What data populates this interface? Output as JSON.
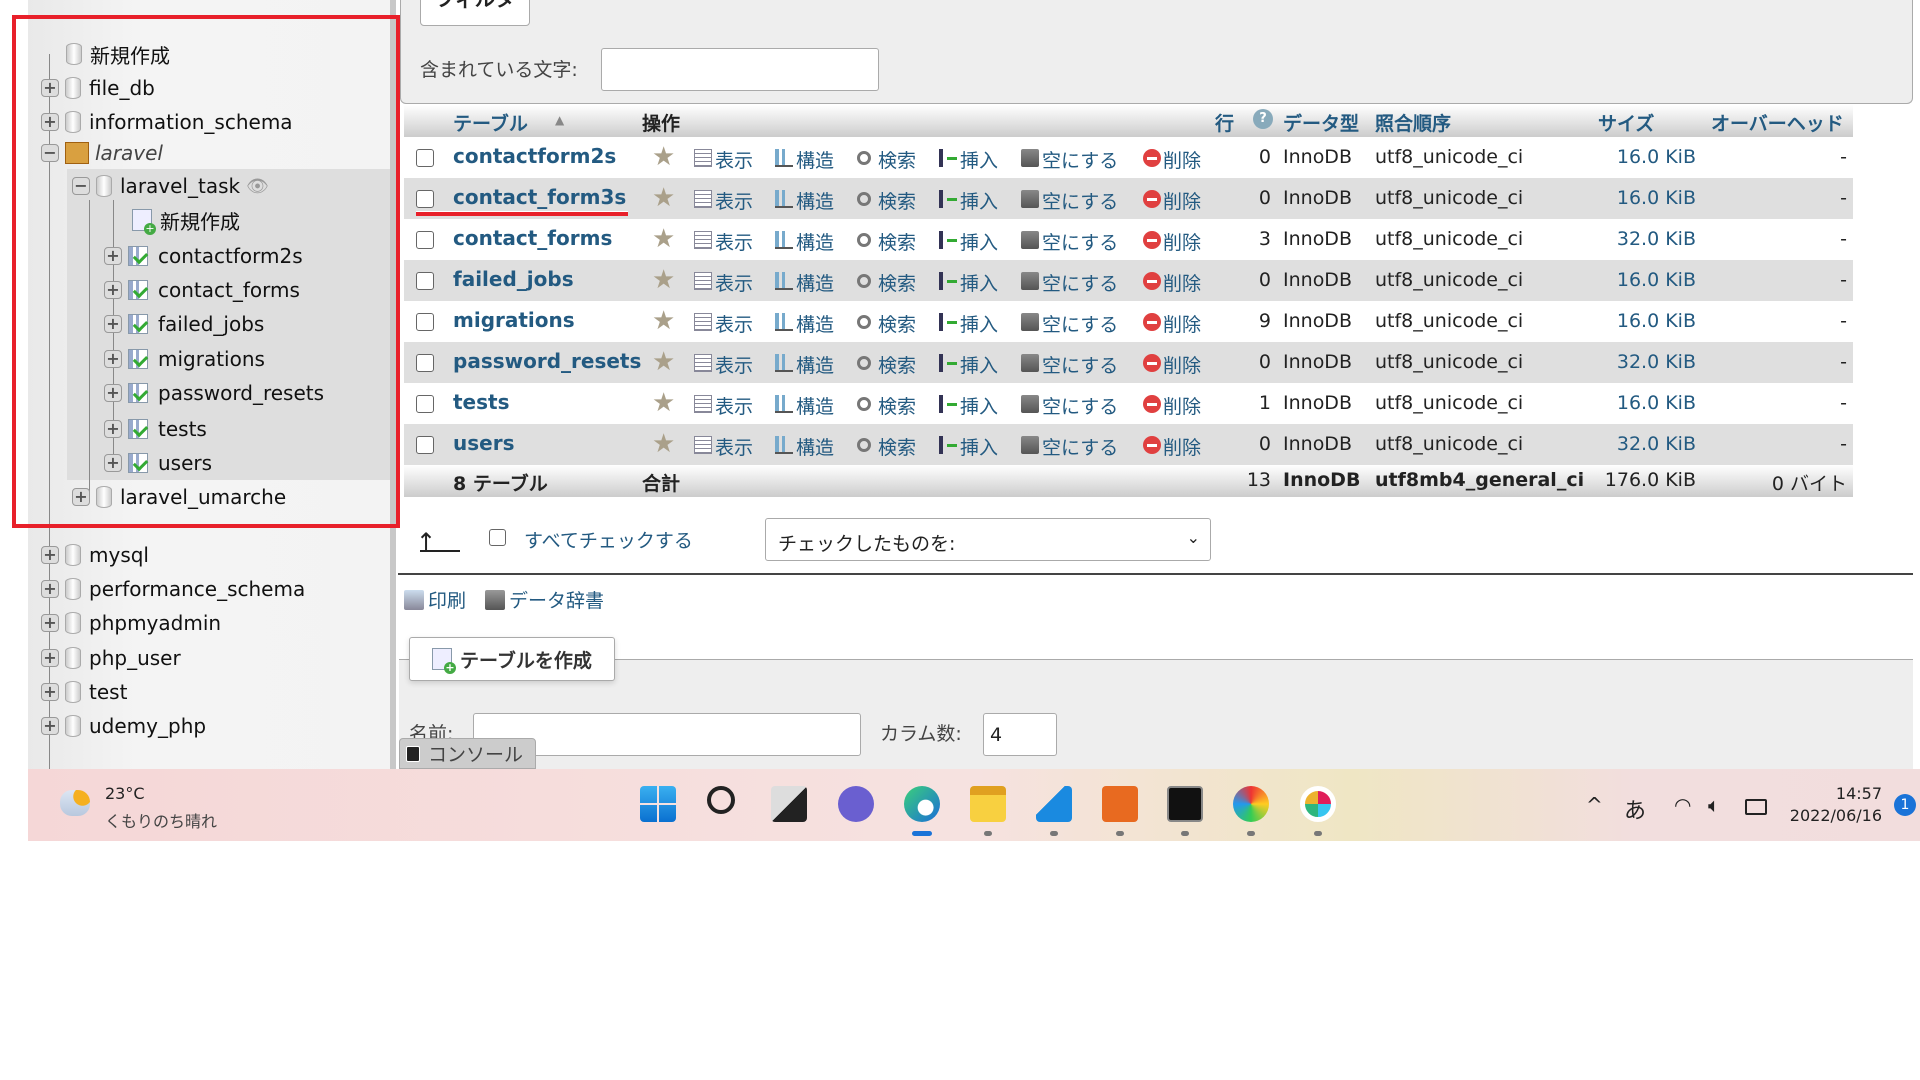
{
  "sidebar": {
    "items": [
      {
        "label": "新規作成",
        "kind": "new"
      },
      {
        "label": "file_db",
        "kind": "db"
      },
      {
        "label": "information_schema",
        "kind": "db"
      },
      {
        "label": "laravel",
        "kind": "group"
      },
      {
        "label": "laravel_task",
        "kind": "db-open"
      },
      {
        "label": "新規作成",
        "kind": "new-table"
      },
      {
        "label": "contactform2s",
        "kind": "table"
      },
      {
        "label": "contact_forms",
        "kind": "table"
      },
      {
        "label": "failed_jobs",
        "kind": "table"
      },
      {
        "label": "migrations",
        "kind": "table"
      },
      {
        "label": "password_resets",
        "kind": "table"
      },
      {
        "label": "tests",
        "kind": "table"
      },
      {
        "label": "users",
        "kind": "table"
      },
      {
        "label": "laravel_umarche",
        "kind": "db"
      },
      {
        "label": "mysql",
        "kind": "db"
      },
      {
        "label": "performance_schema",
        "kind": "db"
      },
      {
        "label": "phpmyadmin",
        "kind": "db"
      },
      {
        "label": "php_user",
        "kind": "db"
      },
      {
        "label": "test",
        "kind": "db"
      },
      {
        "label": "udemy_php",
        "kind": "db"
      }
    ]
  },
  "filter": {
    "tab": "フィルタ",
    "label": "含まれている文字:",
    "value": ""
  },
  "table": {
    "headers": {
      "table": "テーブル",
      "action": "操作",
      "rows": "行",
      "type": "データ型",
      "collation": "照合順序",
      "size": "サイズ",
      "overhead": "オーバーヘッド"
    },
    "actions": {
      "browse": "表示",
      "structure": "構造",
      "search": "検索",
      "insert": "挿入",
      "empty": "空にする",
      "drop": "削除"
    },
    "rows": [
      {
        "name": "contactform2s",
        "rows": "0",
        "type": "InnoDB",
        "collation": "utf8_unicode_ci",
        "size": "16.0 KiB",
        "overhead": "-"
      },
      {
        "name": "contact_form3s",
        "rows": "0",
        "type": "InnoDB",
        "collation": "utf8_unicode_ci",
        "size": "16.0 KiB",
        "overhead": "-"
      },
      {
        "name": "contact_forms",
        "rows": "3",
        "type": "InnoDB",
        "collation": "utf8_unicode_ci",
        "size": "32.0 KiB",
        "overhead": "-"
      },
      {
        "name": "failed_jobs",
        "rows": "0",
        "type": "InnoDB",
        "collation": "utf8_unicode_ci",
        "size": "16.0 KiB",
        "overhead": "-"
      },
      {
        "name": "migrations",
        "rows": "9",
        "type": "InnoDB",
        "collation": "utf8_unicode_ci",
        "size": "16.0 KiB",
        "overhead": "-"
      },
      {
        "name": "password_resets",
        "rows": "0",
        "type": "InnoDB",
        "collation": "utf8_unicode_ci",
        "size": "32.0 KiB",
        "overhead": "-"
      },
      {
        "name": "tests",
        "rows": "1",
        "type": "InnoDB",
        "collation": "utf8_unicode_ci",
        "size": "16.0 KiB",
        "overhead": "-"
      },
      {
        "name": "users",
        "rows": "0",
        "type": "InnoDB",
        "collation": "utf8_unicode_ci",
        "size": "32.0 KiB",
        "overhead": "-"
      }
    ],
    "total": {
      "name": "8 テーブル",
      "label": "合計",
      "rows": "13",
      "type": "InnoDB",
      "collation": "utf8mb4_general_ci",
      "size": "176.0 KiB",
      "overhead": "0 バイト"
    }
  },
  "bulk": {
    "check_all": "すべてチェックする",
    "select": "チェックしたものを:"
  },
  "links": {
    "print": "印刷",
    "dictionary": "データ辞書"
  },
  "create": {
    "button": "テーブルを作成",
    "name_label": "名前:",
    "name_value": "",
    "cols_label": "カラム数:",
    "cols_value": "4"
  },
  "console": {
    "label": "コンソール"
  },
  "taskbar": {
    "weather": {
      "temp": "23°C",
      "desc": "くもりのち晴れ"
    },
    "apps": [
      "windows-start",
      "search",
      "task-view",
      "teams-chat",
      "edge",
      "file-explorer",
      "vscode",
      "xampp",
      "terminal",
      "paint",
      "slack"
    ],
    "tray": {
      "chevron": "^",
      "ime": "あ",
      "time": "14:57",
      "date": "2022/06/16",
      "notifications": "1"
    }
  },
  "colors": {
    "link": "#235a81",
    "highlight": "#e8202a",
    "row_alt": "#dfdfdf"
  }
}
